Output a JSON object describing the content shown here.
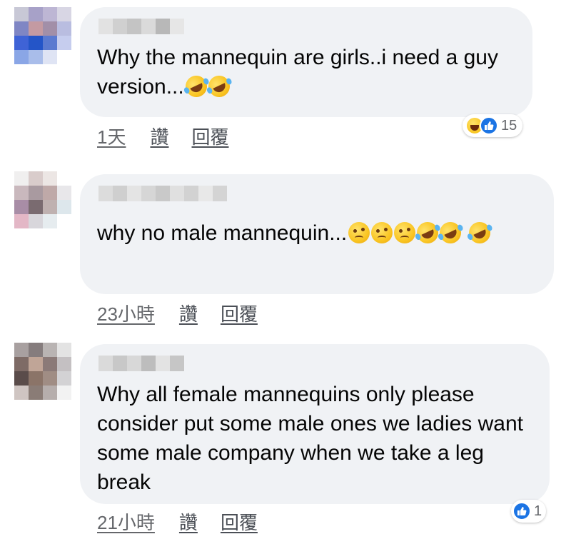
{
  "colors": {
    "bubble": "#f0f2f5",
    "meta_text": "#65676b",
    "like_blue": "#1b74e4"
  },
  "comments": [
    {
      "text": "Why the mannequin are girls..i need a guy version...",
      "emojis": [
        "rolling-on-floor-laughing",
        "rolling-on-floor-laughing"
      ],
      "time": "1天",
      "like_label": "讚",
      "reply_label": "回覆",
      "reactions": {
        "icons": [
          "haha",
          "like"
        ],
        "count": "15"
      }
    },
    {
      "text": "why no male mannequin...",
      "emojis": [
        "woozy-face",
        "woozy-face",
        "woozy-face",
        "rolling-on-floor-laughing",
        "rolling-on-floor-laughing",
        "rolling-on-floor-laughing"
      ],
      "time": "23小時",
      "like_label": "讚",
      "reply_label": "回覆"
    },
    {
      "text": "Why all female mannequins only please consider put some male ones we ladies want some male company when we take a leg break",
      "time": "21小時",
      "like_label": "讚",
      "reply_label": "回覆",
      "reactions": {
        "icons": [
          "like"
        ],
        "count": "1"
      }
    }
  ]
}
